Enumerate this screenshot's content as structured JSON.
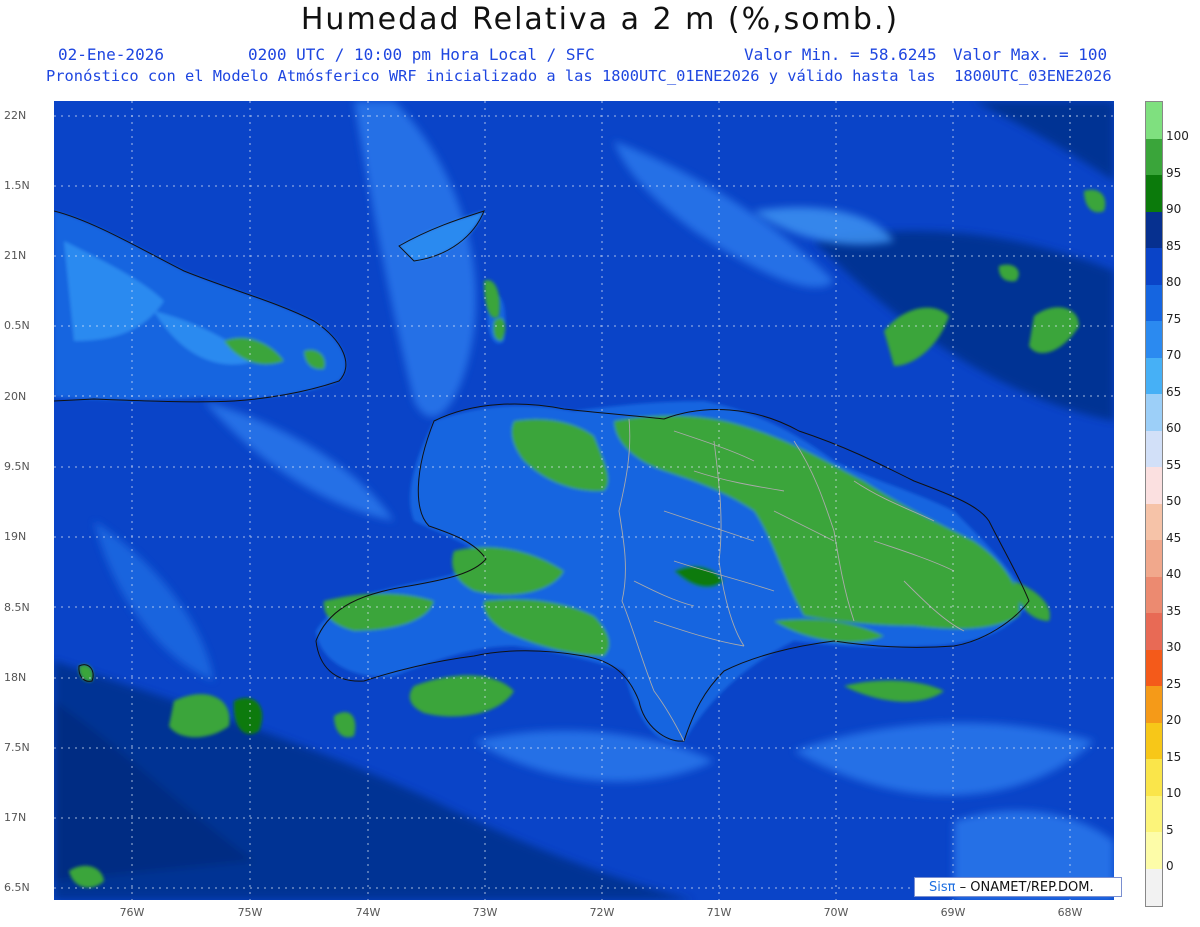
{
  "header": {
    "title": "Humedad Relativa a 2 m (%,somb.)",
    "date": "02-Ene-2026",
    "time_info": "0200 UTC / 10:00 pm Hora Local / SFC",
    "min_label": "Valor Min. = 58.6245",
    "max_label": "Valor Max. = 100",
    "model_info": "Pronóstico con el Modelo Atmósferico WRF inicializado a las 1800UTC_01ENE2026 y válido hasta las  1800UTC_03ENE2026"
  },
  "map_data": {
    "lat_labels": [
      "22N",
      "1.5N",
      "21N",
      "0.5N",
      "20N",
      "9.5N",
      "19N",
      "8.5N",
      "18N",
      "7.5N",
      "17N",
      "6.5N"
    ],
    "lon_labels": [
      "76W",
      "75W",
      "74W",
      "73W",
      "72W",
      "71W",
      "70W",
      "69W",
      "68W"
    ],
    "colors": {
      "ocean_base": "#0a44c8",
      "ocean_light": "#2a78ec",
      "ocean_dark": "#05339e",
      "land_green": "#3aa53a",
      "land_dark_green": "#0b7a0b",
      "coast": "#111111",
      "border": "#aaaaaa"
    }
  },
  "colorbar": {
    "ticks": [
      "100",
      "95",
      "90",
      "85",
      "80",
      "75",
      "70",
      "65",
      "60",
      "55",
      "50",
      "45",
      "40",
      "35",
      "30",
      "25",
      "20",
      "15",
      "10",
      "5",
      "0"
    ],
    "colors": [
      "#7fe07f",
      "#3aa53a",
      "#0b7a0b",
      "#06308f",
      "#0a44c8",
      "#1565e0",
      "#2b8af0",
      "#46b0f6",
      "#9ccff8",
      "#d2e0f8",
      "#fbe0e0",
      "#f6c3a8",
      "#f1a88c",
      "#ec8a70",
      "#e86a55",
      "#f45a1a",
      "#f59a18",
      "#f7c718",
      "#fae54a",
      "#fcf47a",
      "#fdfca8",
      "#f2f2f2"
    ]
  },
  "credit": {
    "logo": "Sisπ",
    "text": "– ONAMET/REP.DOM."
  }
}
